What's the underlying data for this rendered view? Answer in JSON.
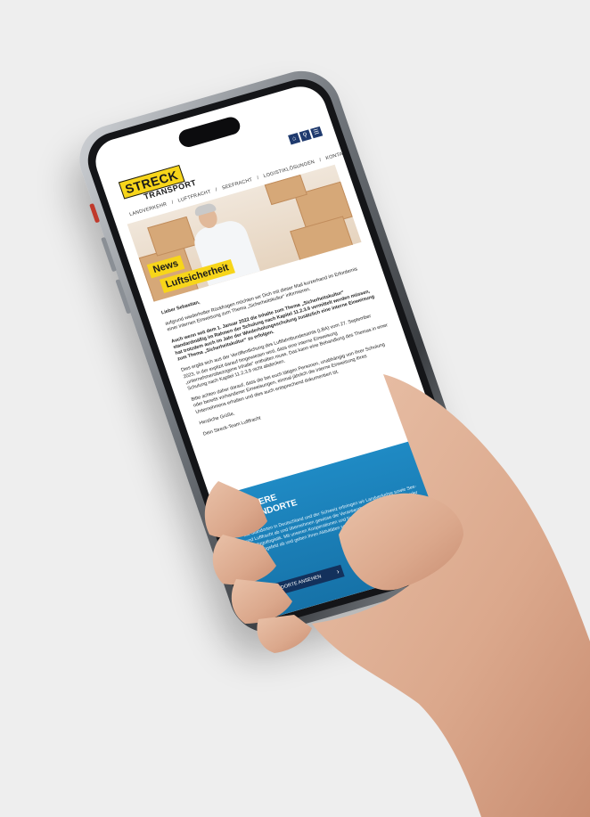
{
  "logo": {
    "streck": "STRECK",
    "transport": "TRANSPORT"
  },
  "header_icons": [
    "⌂",
    "⚲",
    "☰"
  ],
  "nav": [
    "LANDVERKEHR",
    "/",
    "LUFTFRACHT",
    "/",
    "SEEFRACHT",
    "/",
    "LOGISTIKLÖSUNGEN",
    "/",
    "KONTAKT"
  ],
  "hero": {
    "tag1": "News",
    "tag2": "Luftsicherheit"
  },
  "email": {
    "greeting": "Lieber Sebastian,",
    "p1": "aufgrund wiederholter Rückfragen möchten wir Dich mit dieser Mail kurzerhand im Erfordernis einer internen Einweisung zum Thema „Sicherheitskultur“ informieren.",
    "p2": "Auch wenn seit dem 1. Januar 2022 die Inhalte zum Thema „Sicherheitskultur“ standardmäßig im Rahmen der Schulung nach Kapitel 11.2.3.9 vermittelt werden müssen, hat trotzdem auch im Jahr der Wiederholungsschulung zusätzlich eine interne Einweisung zum Thema „Sicherheitskultur“ zu erfolgen.",
    "p3": "Dies ergibt sich aus der Veröffentlichung des Luftfahrtbundesamts (LBA) vom 27. September 2023, in der explizit darauf hingewiesen wird, dass eine interne Einweisung „unternehmensbezogene Inhalte“ enthalten muss. Das kann eine Behandlung des Themas in einer Schulung nach Kapitel 11.2.3.9 nicht abdecken.",
    "p4": "Bitte achten daher darauf, dass die bei euch tätigen Personen, unabhängig von ihrer Schulung oder bereits vorhandener Einweisungen, einmal jährlich die interne Einweisung Ihres Unternehmens erhalten und dies auch entsprechend dokumentiert ist.",
    "closing": "Herzliche Grüße,",
    "signature": "Dein Streck-Team Luftfracht"
  },
  "standorte": {
    "title_line1": "UNSERE",
    "title_line2": "STANDORTE",
    "text": "Mit Standorten in Deutschland und der Schweiz erbringen wir Landverkehre sowie See- und Luftfracht ab und übernehmen gewisse die Verantwortung der Lagerlogistiken oder Gefahrgutlogistik. Mit unseren Kooperationen und Netzwerken sind ein globales Handlungsfeld ab und geben Ihren Aktivitäten so nahezu jeden Platz der Welt bereit.",
    "button": "STANDORTE ANSEHEN",
    "button_arrow": "›"
  },
  "colors": {
    "brand_yellow": "#f7d51a",
    "brand_blue": "#1f8ac4",
    "navy": "#13315c"
  }
}
